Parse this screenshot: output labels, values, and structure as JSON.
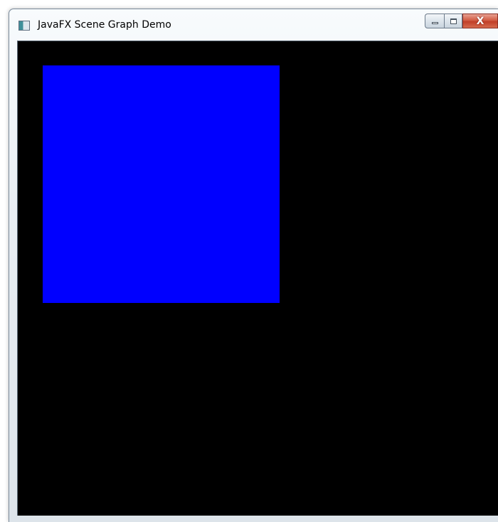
{
  "window": {
    "title": "JavaFX Scene Graph Demo",
    "icon": "javafx-app-icon",
    "controls": {
      "minimize_icon": "minimize-icon",
      "maximize_icon": "maximize-icon",
      "close_icon": "close-icon",
      "close_glyph": "X"
    }
  },
  "scene": {
    "background_color": "#000000",
    "rectangle_color": "#0000ff"
  }
}
